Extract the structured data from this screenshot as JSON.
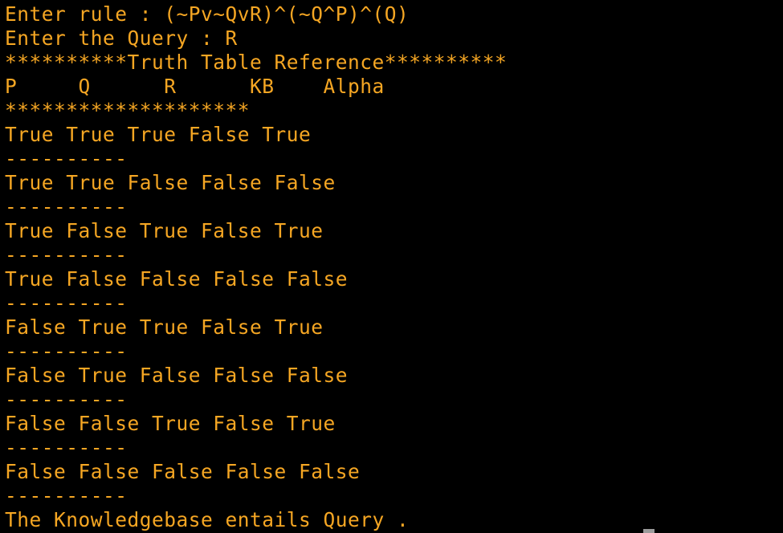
{
  "theme": {
    "background": "#000000",
    "text_color": "#f5a623",
    "cursor_color": "#9b9b9b"
  },
  "terminal": {
    "lines": [
      "Enter rule : (~Pv~QvR)^(~Q^P)^(Q)",
      "Enter the Query : R",
      "**********Truth Table Reference**********",
      "P     Q      R      KB    Alpha",
      "********************",
      "True True True False True",
      "----------",
      "True True False False False",
      "----------",
      "True False True False True",
      "----------",
      "True False False False False",
      "----------",
      "False True True False True",
      "----------",
      "False True False False False",
      "----------",
      "False False True False True",
      "----------",
      "False False False False False",
      "----------",
      "The Knowledgebase entails Query ."
    ]
  }
}
